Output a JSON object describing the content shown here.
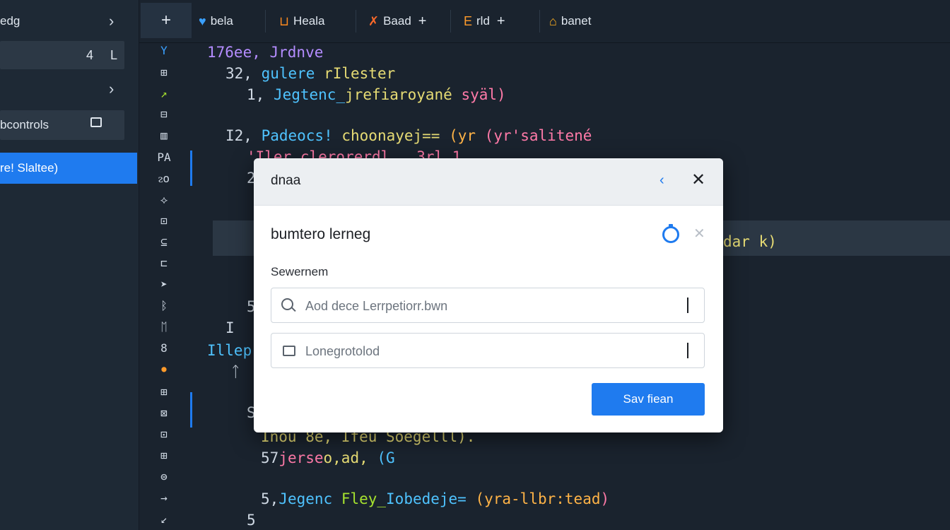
{
  "sidebar": {
    "row1": "edg",
    "row2_count": "4",
    "row2_letter": "L",
    "row4": "bcontrols",
    "row5": "re! Slaltee)"
  },
  "tabs": {
    "plus": "+",
    "tab1": "bela",
    "tab2": "Heala",
    "tab3": "Baad",
    "tab4": "rld",
    "tab5": "banet",
    "tab_add": "+"
  },
  "gutter": {
    "icons": [
      "Y",
      "⊞",
      "↗",
      "⊟",
      "▥",
      "PA",
      "ᴤo",
      "⟡",
      "⊡",
      "⊆",
      "⊏",
      "➤",
      "ᛒ",
      "ᛖ",
      "8",
      "●",
      "⊞",
      "⊠",
      "⊡",
      "⊞",
      "⊜",
      "→",
      "↙"
    ]
  },
  "code": {
    "l1": "176ee, Jrdnve",
    "l2a": "32, ",
    "l2b": "gulere ",
    "l2c": "rIlester",
    "l3a": "1, ",
    "l3b": "Jegtenc_",
    "l3c": "jrefiaroyané ",
    "l3d": "syäl)",
    "l4a": "I2, ",
    "l4b": "Padeocs! ",
    "l4c": "choonayej== ",
    "l4d": "(yr ",
    "l4e": "(yr'salitené",
    "l5": "'Iler.clerorerdl_  3rl.1",
    "l6": "2",
    "hl_tail": "dar k)",
    "l7": "5",
    "l8": "I",
    "l9": "Illep",
    "l10": "ᛏ",
    "l11": "S",
    "l12": "Inou 8e, Ifeu Soegelll).",
    "l13a": "57",
    "l13b": "jerse",
    "l13c": "o,ad, ",
    "l13d": "(G",
    "l14a": "5,",
    "l14b": "Jegenc ",
    "l14c": "Fley_",
    "l14d": "Iobedeje=",
    "l14e": " (yra-llbr:tead",
    "l14f": ")",
    "l15": "5"
  },
  "dialog": {
    "title": "dnaa",
    "back": "‹",
    "close": "✕",
    "subtitle": "bumtero lerneg",
    "dismiss": "✕",
    "section_label": "Sewernem",
    "search_placeholder": "Aod dece Lerrpetiorr.bwn",
    "second_placeholder": "Lonegrotolod",
    "button": "Sav fiean"
  },
  "colors": {
    "accent": "#1f7bef",
    "editor_bg": "#1a232e",
    "sidebar_bg": "#1e2935"
  }
}
